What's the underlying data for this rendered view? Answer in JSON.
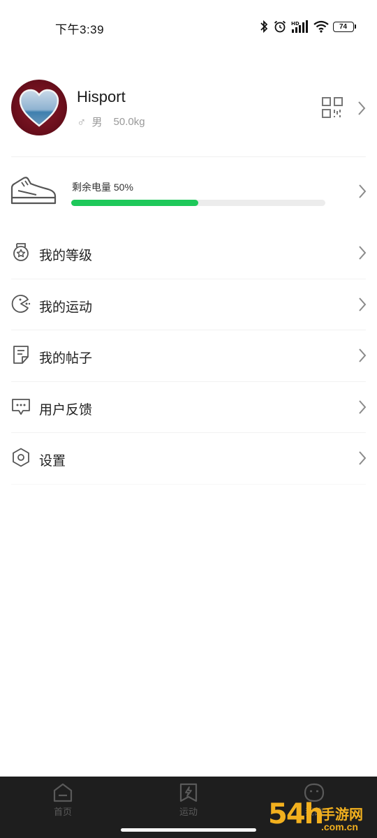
{
  "status_bar": {
    "time": "下午3:39",
    "battery_level": "74",
    "icons": [
      "bluetooth-icon",
      "alarm-icon",
      "hd-signal-icon",
      "wifi-icon",
      "battery-icon"
    ]
  },
  "profile": {
    "name": "Hisport",
    "gender_symbol": "♂",
    "gender": "男",
    "weight": "50.0kg"
  },
  "device": {
    "battery_label": "剩余电量 50%",
    "battery_percent": 50,
    "fill_color": "#1ec85a"
  },
  "menu": {
    "items": [
      {
        "label": "我的等级",
        "icon": "medal-icon"
      },
      {
        "label": "我的运动",
        "icon": "sport-icon"
      },
      {
        "label": "我的帖子",
        "icon": "post-icon"
      },
      {
        "label": "用户反馈",
        "icon": "feedback-icon"
      },
      {
        "label": "设置",
        "icon": "settings-icon"
      }
    ]
  },
  "bottom_nav": {
    "items": [
      {
        "label": "首页",
        "icon": "home-icon"
      },
      {
        "label": "运动",
        "icon": "lightning-icon"
      },
      {
        "label": "我的",
        "icon": "face-icon"
      }
    ]
  },
  "watermark": {
    "number": "54h",
    "site": "手游网",
    "domain": ".com.cn"
  },
  "colors": {
    "accent_green": "#1ec85a",
    "nav_background": "#1e1e1e",
    "watermark": "#f2b01e"
  }
}
